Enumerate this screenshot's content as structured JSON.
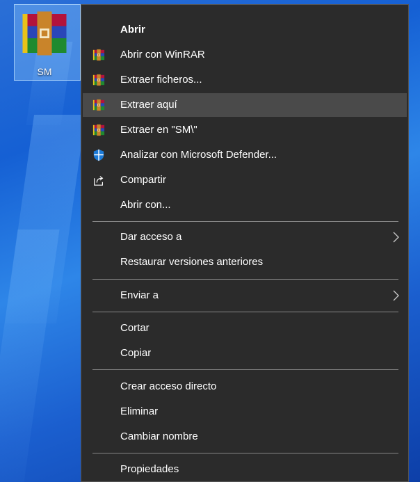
{
  "desktop": {
    "icon_label": "SM",
    "icon_name": "winrar-archive-icon"
  },
  "menu": {
    "items": [
      {
        "label": "Abrir",
        "icon": "",
        "bold": true
      },
      {
        "label": "Abrir con WinRAR",
        "icon": "winrar-icon"
      },
      {
        "label": "Extraer ficheros...",
        "icon": "winrar-icon"
      },
      {
        "label": "Extraer aquí",
        "icon": "winrar-icon",
        "highlighted": true
      },
      {
        "label": "Extraer en \"SM\\\"",
        "icon": "winrar-icon"
      },
      {
        "label": "Analizar con Microsoft Defender...",
        "icon": "defender-shield-icon"
      },
      {
        "label": "Compartir",
        "icon": "share-icon"
      },
      {
        "label": "Abrir con...",
        "icon": ""
      },
      {
        "label": "Dar acceso a",
        "icon": "",
        "submenu": true
      },
      {
        "label": "Restaurar versiones anteriores",
        "icon": ""
      },
      {
        "label": "Enviar a",
        "icon": "",
        "submenu": true
      },
      {
        "label": "Cortar",
        "icon": ""
      },
      {
        "label": "Copiar",
        "icon": ""
      },
      {
        "label": "Crear acceso directo",
        "icon": ""
      },
      {
        "label": "Eliminar",
        "icon": ""
      },
      {
        "label": "Cambiar nombre",
        "icon": ""
      },
      {
        "label": "Propiedades",
        "icon": ""
      }
    ]
  },
  "colors": {
    "menu_background": "#2b2b2b",
    "menu_highlight": "#4a4a4a",
    "separator": "#888888",
    "desktop_blue": "#1560d4",
    "defender_blue": "#1c7bd8"
  }
}
